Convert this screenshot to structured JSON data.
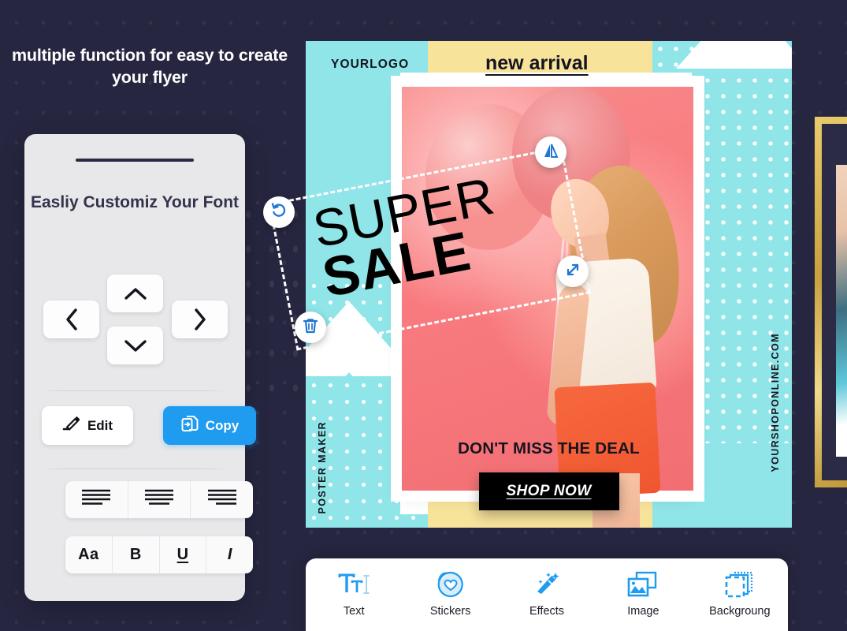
{
  "headline": "multiple function for\neasy to create your flyer",
  "panel": {
    "title": "Easliy Customiz\nYour Font",
    "dpad": {
      "up": "chevron-up",
      "down": "chevron-down",
      "left": "chevron-left",
      "right": "chevron-right"
    },
    "edit_label": "Edit",
    "copy_label": "Copy",
    "align": [
      {
        "name": "align-left",
        "label": "Align left"
      },
      {
        "name": "align-center",
        "label": "Align center"
      },
      {
        "name": "align-right",
        "label": "Align right"
      }
    ],
    "style": [
      {
        "name": "font-case",
        "label": "Aa"
      },
      {
        "name": "bold",
        "label": "B"
      },
      {
        "name": "underline",
        "label": "U"
      },
      {
        "name": "italic",
        "label": "I"
      }
    ]
  },
  "poster": {
    "logo": "YOURLOGO",
    "headline": "new arrival",
    "selected_text_line1": "SUPER",
    "selected_text_line2": "SALE",
    "deal_text": "DON'T MISS THE DEAL",
    "cta_label": "SHOP NOW",
    "vertical_left": "POSTER MAKER",
    "vertical_right": "YOURSHOPONLINE.COM",
    "handles": [
      {
        "name": "rotate-handle",
        "icon": "rotate-icon"
      },
      {
        "name": "flip-handle",
        "icon": "flip-icon"
      },
      {
        "name": "resize-handle",
        "icon": "resize-arrow-icon"
      },
      {
        "name": "delete-handle",
        "icon": "trash-icon"
      }
    ]
  },
  "toolbar": {
    "items": [
      {
        "label": "Text",
        "icon": "text-tool-icon"
      },
      {
        "label": "Stickers",
        "icon": "sticker-heart-icon"
      },
      {
        "label": "Effects",
        "icon": "magic-wand-icon"
      },
      {
        "label": "Image",
        "icon": "image-icon"
      },
      {
        "label": "Backgroung",
        "icon": "background-layers-icon"
      }
    ]
  },
  "colors": {
    "background": "#262640",
    "panel": "#e8e8ea",
    "accent_blue": "#1f9bf0",
    "poster_cyan": "#8fe5e8",
    "poster_yellow": "#f8e39b",
    "poster_pink": "#f87a7f"
  }
}
